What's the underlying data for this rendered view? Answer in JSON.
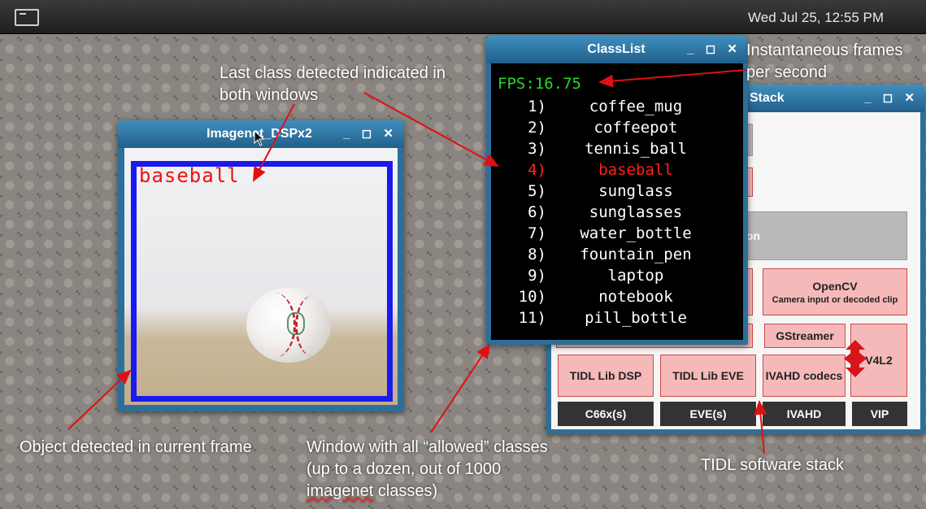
{
  "topbar": {
    "clock": "Wed Jul 25, 12:55 PM",
    "terminal_icon": "terminal-icon"
  },
  "window_controls": "_ ◻ ✕",
  "imagenet_window": {
    "title": "Imagenet_DSPx2",
    "detected_label": "baseball"
  },
  "classlist_window": {
    "title": "ClassList",
    "fps": "FPS:16.75",
    "classes": [
      {
        "num": "1)",
        "name": "coffee_mug"
      },
      {
        "num": "2)",
        "name": "coffeepot"
      },
      {
        "num": "3)",
        "name": "tennis_ball"
      },
      {
        "num": "4)",
        "name": "baseball",
        "active": true
      },
      {
        "num": "5)",
        "name": "sunglass"
      },
      {
        "num": "6)",
        "name": "sunglasses"
      },
      {
        "num": "7)",
        "name": "water_bottle"
      },
      {
        "num": "8)",
        "name": "fountain_pen"
      },
      {
        "num": "9)",
        "name": "laptop"
      },
      {
        "num": "10)",
        "name": "notebook"
      },
      {
        "num": "11)",
        "name": "pill_bottle"
      }
    ]
  },
  "stack_window": {
    "title": "Stack",
    "grey_bar_text": "ation",
    "opencv": {
      "title": "OpenCV",
      "sub": "Camera input or decoded clip"
    },
    "gstreamer": "GStreamer",
    "v4l2": "V4L2",
    "tidl_dsp": "TIDL Lib DSP",
    "tidl_eve": "TIDL Lib EVE",
    "ivahd_codecs": "IVAHD codecs",
    "hw": [
      "C66x(s)",
      "EVE(s)",
      "IVAHD",
      "VIP"
    ]
  },
  "annotations": {
    "last_class": "Last class detected indicated in both windows",
    "fps_note": "Instantaneous frames per second",
    "object_detected": "Object detected in current frame",
    "window_allowed_1": "Window with all “allowed” classes (up to a dozen, out of 1000 ",
    "window_allowed_2": "imagenet",
    "window_allowed_3": " classes)",
    "tidl_stack": "TIDL software stack"
  },
  "colors": {
    "active_class": "#ff2020",
    "fps": "#27d827",
    "bbox": "#1a1af0",
    "annotation_arrow": "#e01010"
  }
}
